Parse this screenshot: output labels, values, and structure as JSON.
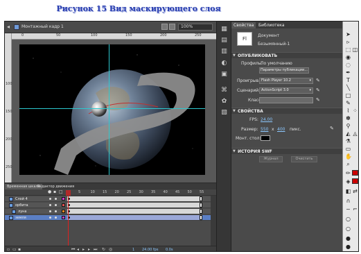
{
  "caption": "Рисунок 15 Вид маскирующего слоя",
  "stage": {
    "scene_label": "Монтажный кадр 1",
    "zoom": "100%",
    "ruler_top": [
      "0",
      "50",
      "100",
      "150",
      "200",
      "250"
    ],
    "ruler_left": [
      "100",
      "150",
      "200",
      "250"
    ]
  },
  "timeline": {
    "tabs": [
      "Временная шкала",
      "Редактор движения"
    ],
    "frame_numbers": [
      "5",
      "10",
      "15",
      "20",
      "25",
      "30",
      "35",
      "40",
      "45",
      "50",
      "55"
    ],
    "layers": [
      {
        "name": "Слой 4",
        "color": "#d03ad0",
        "selected": false
      },
      {
        "name": "орбита",
        "color": "#e05050",
        "selected": false
      },
      {
        "name": "луна",
        "color": "#f08a20",
        "selected": false
      },
      {
        "name": "земля",
        "color": "#c040c0",
        "selected": true
      }
    ],
    "bottom_values": [
      "1",
      "24.00 fps",
      "0.0s"
    ]
  },
  "properties": {
    "tabs": [
      "Свойства",
      "Библиотека"
    ],
    "doc_type": "Документ",
    "doc_icon_text": "Fl",
    "doc_name": "Безымянный-1",
    "publish_header": "ОПУБЛИКОВАТЬ",
    "profile_label": "Профиль:",
    "profile_value": "По умолчанию",
    "publish_params_button": "Параметры публикации...",
    "player_label": "Проигрыв.:",
    "player_value": "Flash Player 10.2",
    "script_label": "Сценарий:",
    "script_value": "ActionScript 3.0",
    "class_label": "Класс:",
    "props_header": "СВОЙСТВА",
    "fps_label": "FPS:",
    "fps_value": "24.00",
    "size_label": "Размер:",
    "width": "550",
    "times": "x",
    "height": "400",
    "unit": "пикс.",
    "stage_label": "Монт. стол:",
    "stage_color": "#000000",
    "history_header": "ИСТОРИЯ SWF",
    "log_button": "Журнал",
    "clear_button": "Очистить"
  },
  "colors": {
    "guide": "#2cc9d0",
    "playhead": "#e02020",
    "stroke_color": "#cc0000",
    "fill_color": "#cc0000"
  }
}
